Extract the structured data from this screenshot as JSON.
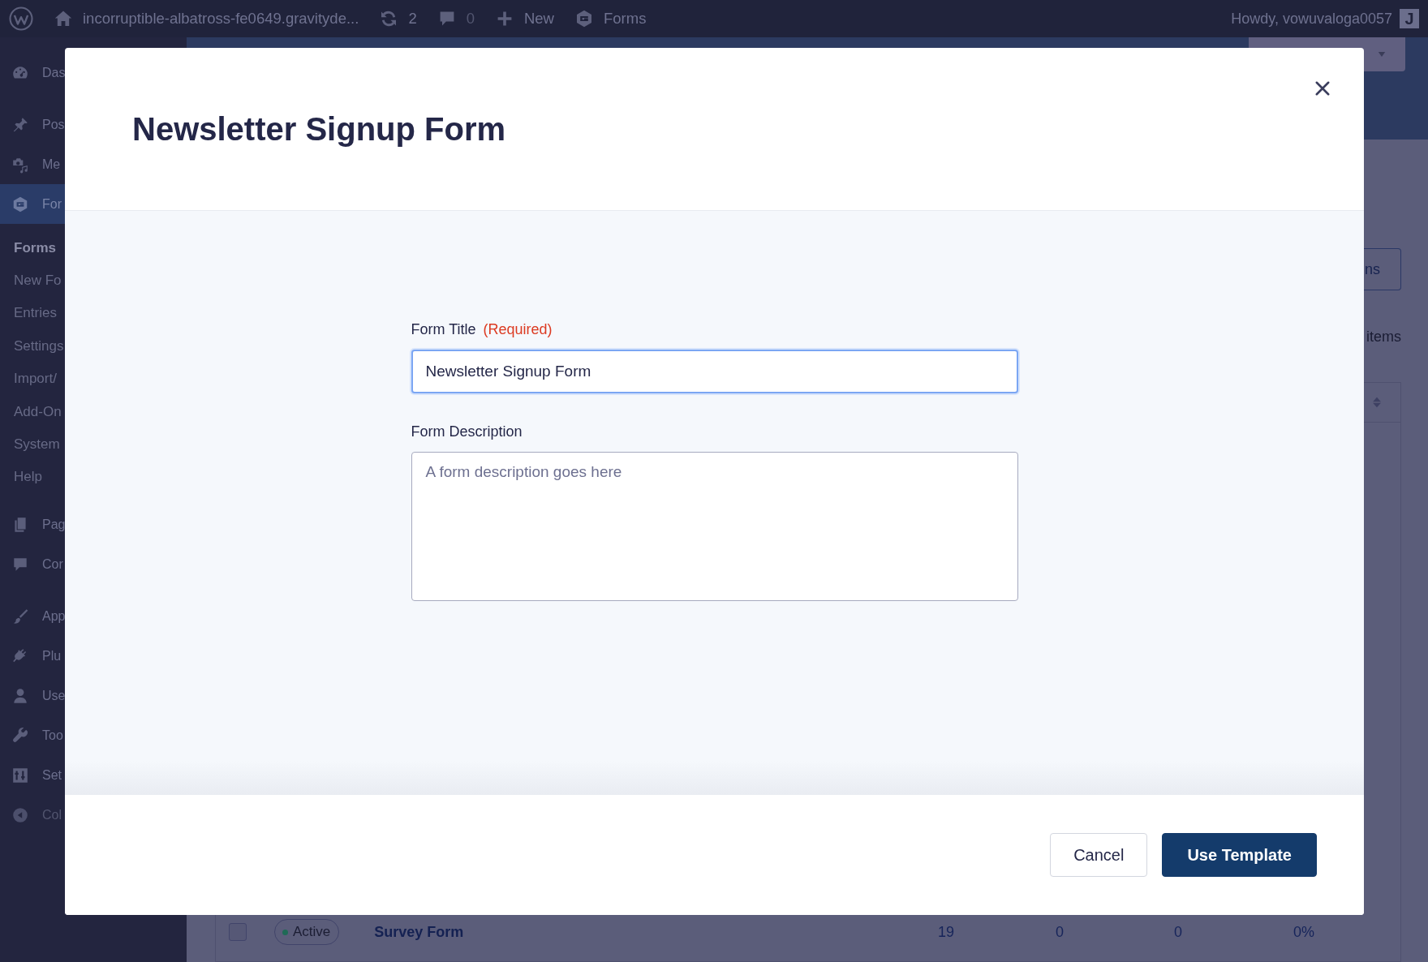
{
  "admin_bar": {
    "items": [
      {
        "kind": "home",
        "label": "incorruptible-albatross-fe0649.gravityde..."
      },
      {
        "kind": "updates",
        "label": "2"
      },
      {
        "kind": "comments",
        "label": "0"
      },
      {
        "kind": "new",
        "label": "New"
      },
      {
        "kind": "forms",
        "label": "Forms"
      }
    ],
    "user": {
      "greeting": "Howdy, vowuvaloga0057",
      "avatar_letter": "J"
    }
  },
  "sidebar": {
    "groups": [
      {
        "items": [
          {
            "kind": "dashboard",
            "label": "Das",
            "selected": false
          }
        ]
      },
      {
        "items": [
          {
            "kind": "pin",
            "label": "Pos",
            "selected": false
          },
          {
            "kind": "media",
            "label": "Me",
            "selected": false
          },
          {
            "kind": "forms",
            "label": "For",
            "selected": true,
            "children": [
              {
                "label": "Forms",
                "selected": true
              },
              {
                "label": "New Fo",
                "selected": false
              },
              {
                "label": "Entries",
                "selected": false
              },
              {
                "label": "Settings",
                "selected": false
              },
              {
                "label": "Import/",
                "selected": false
              },
              {
                "label": "Add-On",
                "selected": false
              },
              {
                "label": "System",
                "selected": false
              },
              {
                "label": "Help",
                "selected": false
              }
            ]
          },
          {
            "kind": "pages",
            "label": "Pag",
            "selected": false
          },
          {
            "kind": "comment",
            "label": "Cor",
            "selected": false
          }
        ]
      },
      {
        "items": [
          {
            "kind": "brush",
            "label": "App",
            "selected": false
          },
          {
            "kind": "plug",
            "label": "Plu",
            "selected": false
          },
          {
            "kind": "user",
            "label": "Use",
            "selected": false
          },
          {
            "kind": "wrench",
            "label": "Too",
            "selected": false
          },
          {
            "kind": "sliders",
            "label": "Set",
            "selected": false
          }
        ]
      }
    ],
    "collapse": {
      "label": "Col"
    }
  },
  "content": {
    "toolbar_button": "ns",
    "item_count": "items",
    "table": {
      "rows": [
        {
          "checked": false,
          "status": "Active",
          "title": "Survey Form",
          "cells": [
            "19",
            "0",
            "0",
            "0%"
          ]
        }
      ]
    }
  },
  "modal": {
    "title": "Newsletter Signup Form",
    "fields": [
      {
        "kind": "text",
        "label": "Form Title",
        "required_note": "(Required)",
        "value": "Newsletter Signup Form",
        "focused": true
      },
      {
        "kind": "textarea",
        "label": "Form Description",
        "placeholder": "A form description goes here",
        "focused": false
      }
    ],
    "buttons": [
      {
        "kind": "secondary",
        "label": "Cancel"
      },
      {
        "kind": "primary",
        "label": "Use Template"
      }
    ]
  }
}
